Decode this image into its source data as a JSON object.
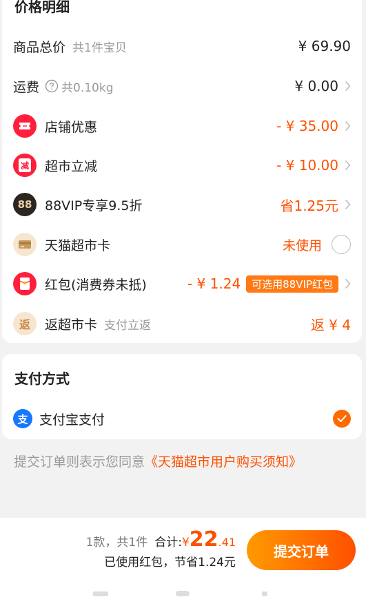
{
  "price_detail": {
    "title": "价格明细",
    "rows": [
      {
        "label": "商品总价",
        "sub": "共1件宝贝",
        "amount": "¥ 69.90"
      },
      {
        "label": "运费",
        "sub": "共0.10kg",
        "amount": "¥ 0.00"
      },
      {
        "label": "店铺优惠",
        "amount": "- ¥ 35.00"
      },
      {
        "label": "超市立减",
        "icon_text": "减",
        "amount": "- ¥ 10.00"
      },
      {
        "label": "88VIP专享9.5折",
        "icon_text": "88",
        "amount": "省1.25元"
      },
      {
        "label": "天猫超市卡",
        "amount": "未使用"
      },
      {
        "label": "红包(消费券未抵)",
        "amount": "- ¥ 1.24",
        "tag": "可选用88VIP红包"
      },
      {
        "label": "返超市卡",
        "icon_text": "返",
        "sub": "支付立返",
        "amount": "返 ¥ 4"
      }
    ]
  },
  "payment": {
    "title": "支付方式",
    "method": "支付宝支付",
    "icon_text": "支"
  },
  "notice": {
    "prefix": "提交订单则表示您同意",
    "link": "《天猫超市用户购买须知》"
  },
  "bottom": {
    "count": "1款，共1件",
    "total_label": "合计:",
    "currency": "¥",
    "total_int": "22",
    "total_dec": ".41",
    "savings": "已使用红包，节省1.24元",
    "submit": "提交订单"
  },
  "colors": {
    "accent": "#ff5000",
    "red_icon": "#ff1f3d",
    "button_start": "#ff9a00",
    "button_end": "#ff5000"
  },
  "icons": [
    "help-circle-icon",
    "ticket-icon",
    "discount-icon",
    "vip-88-icon",
    "card-icon",
    "red-packet-icon",
    "return-icon",
    "alipay-icon",
    "check-icon",
    "chevron-right-icon"
  ]
}
